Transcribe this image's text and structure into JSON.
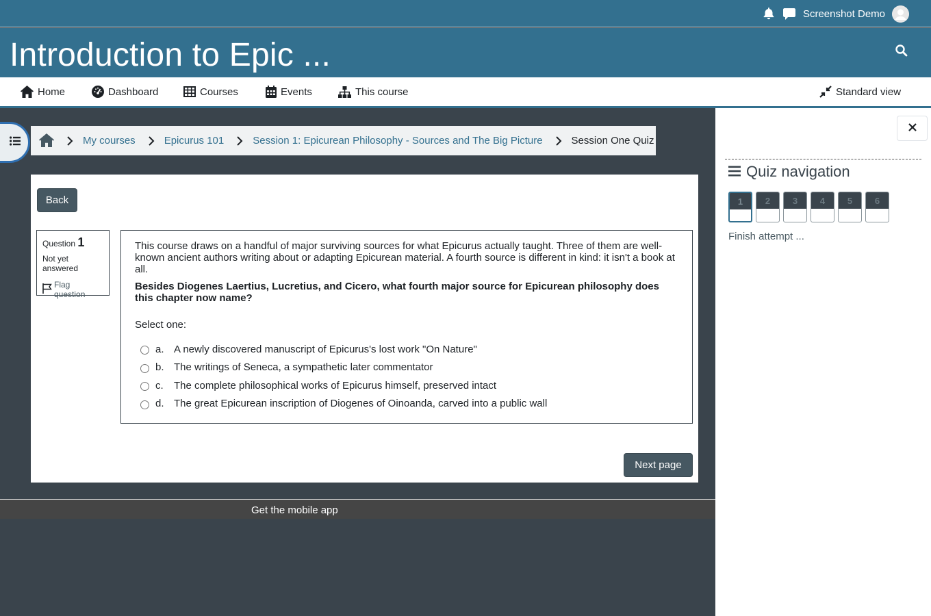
{
  "topbar": {
    "user_name": "Screenshot Demo",
    "icons": [
      "bell-icon",
      "chat-icon",
      "avatar"
    ]
  },
  "header": {
    "course_title": "Introduction to Epic ..."
  },
  "nav": {
    "items": [
      {
        "label": "Home",
        "icon": "home-icon"
      },
      {
        "label": "Dashboard",
        "icon": "dashboard-icon"
      },
      {
        "label": "Courses",
        "icon": "table-icon"
      },
      {
        "label": "Events",
        "icon": "calendar-icon"
      },
      {
        "label": "This course",
        "icon": "sitemap-icon"
      }
    ],
    "view_toggle": "Standard view"
  },
  "breadcrumb": {
    "items": [
      "My courses",
      "Epicurus 101",
      "Session 1: Epicurean Philosophy - Sources and The Big Picture",
      "Session One Quiz"
    ]
  },
  "quiz": {
    "back_label": "Back",
    "question_label": "Question",
    "question_number": "1",
    "state": "Not yet answered",
    "flag_label": "Flag question",
    "intro": "This course draws on a handful of major surviving sources for what Epicurus actually taught. Three of them are well-known ancient authors writing about or adapting Epicurean material. A fourth source is different in kind: it isn't a book at all.",
    "prompt": "Besides Diogenes Laertius, Lucretius, and Cicero, what fourth major source for Epicurean philosophy does this chapter now name?",
    "select_label": "Select one:",
    "answers": [
      {
        "letter": "a.",
        "text": "A newly discovered manuscript of Epicurus's lost work \"On Nature\""
      },
      {
        "letter": "b.",
        "text": "The writings of Seneca, a sympathetic later commentator"
      },
      {
        "letter": "c.",
        "text": "The complete philosophical works of Epicurus himself, preserved intact"
      },
      {
        "letter": "d.",
        "text": "The great Epicurean inscription of Diogenes of Oinoanda, carved into a public wall"
      }
    ],
    "next_label": "Next page"
  },
  "footer": {
    "mobile_app": "Get the mobile app"
  },
  "drawer": {
    "title": "Quiz navigation",
    "questions": [
      "1",
      "2",
      "3",
      "4",
      "5",
      "6"
    ],
    "finish_label": "Finish attempt ..."
  },
  "colors": {
    "brand": "#33708f",
    "dark": "#3a444c",
    "button": "#465862"
  }
}
